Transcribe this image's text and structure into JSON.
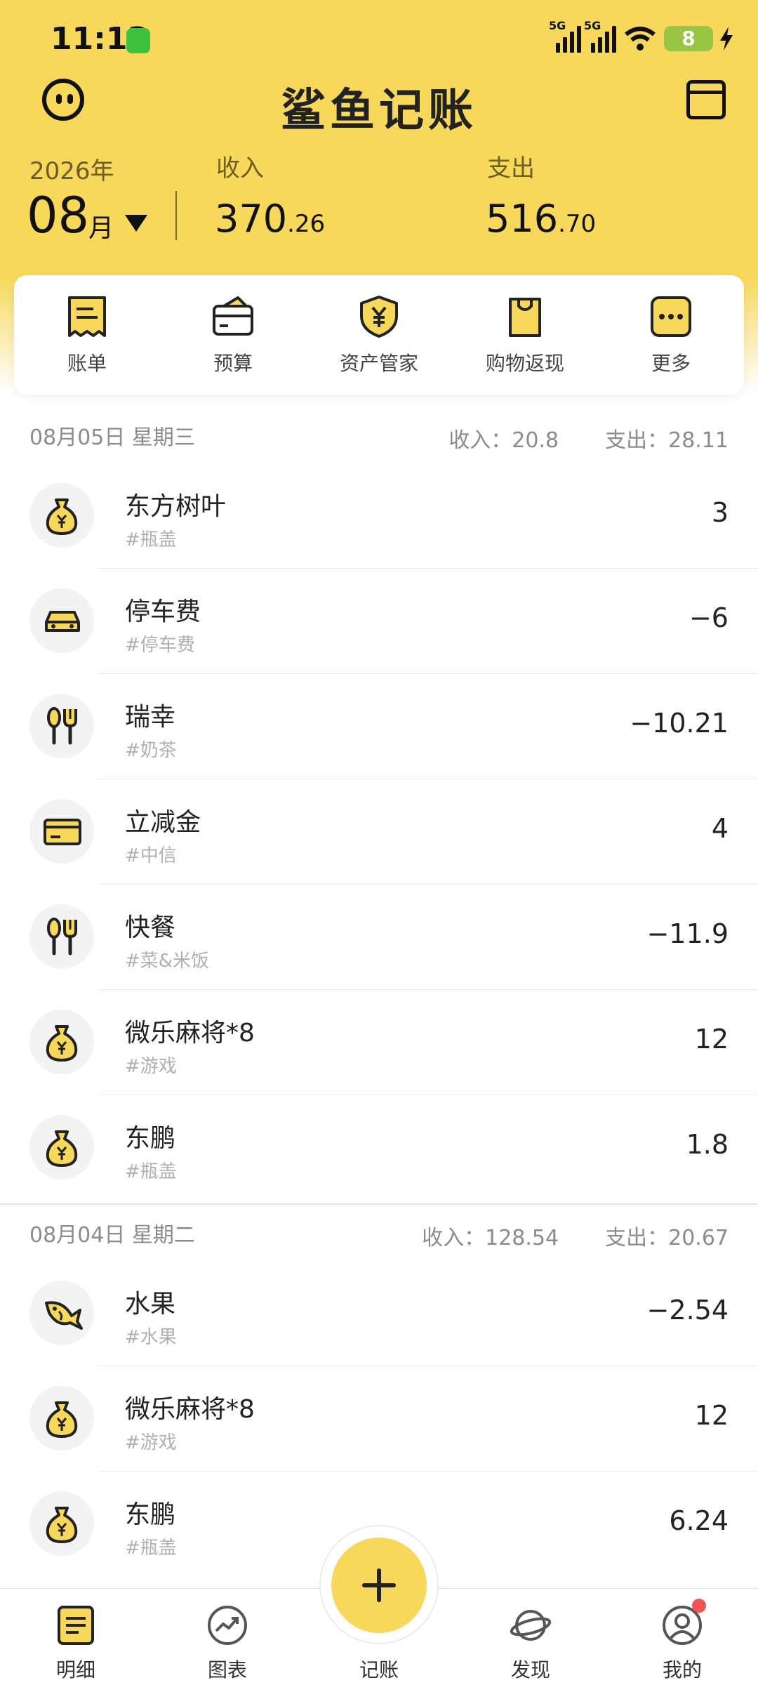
{
  "status_bar": {
    "time": "11:13",
    "signal1": "5G",
    "signal2": "5G",
    "battery": "8"
  },
  "header": {
    "title": "鲨鱼记账",
    "year": "2026年",
    "month": "08",
    "month_unit": "月",
    "income_label": "收入",
    "income_int": "370",
    "income_dec": ".26",
    "expense_label": "支出",
    "expense_int": "516",
    "expense_dec": ".70"
  },
  "quick_actions": [
    {
      "label": "账单",
      "icon": "bill-icon"
    },
    {
      "label": "预算",
      "icon": "wallet-icon"
    },
    {
      "label": "资产管家",
      "icon": "shield-yen-icon"
    },
    {
      "label": "购物返现",
      "icon": "shopping-bag-icon"
    },
    {
      "label": "更多",
      "icon": "more-icon"
    }
  ],
  "days": [
    {
      "date": "08月05日 星期三",
      "income": "收入：20.8",
      "expense": "支出：28.11",
      "items": [
        {
          "name": "东方树叶",
          "tag": "#瓶盖",
          "amount": "3",
          "icon": "money-bag-icon"
        },
        {
          "name": "停车费",
          "tag": "#停车费",
          "amount": "−6",
          "icon": "car-icon"
        },
        {
          "name": "瑞幸",
          "tag": "#奶茶",
          "amount": "−10.21",
          "icon": "cutlery-icon"
        },
        {
          "name": "立减金",
          "tag": "#中信",
          "amount": "4",
          "icon": "card-icon"
        },
        {
          "name": "快餐",
          "tag": "#菜&米饭",
          "amount": "−11.9",
          "icon": "cutlery-icon"
        },
        {
          "name": "微乐麻将*8",
          "tag": "#游戏",
          "amount": "12",
          "icon": "money-bag-icon"
        },
        {
          "name": "东鹏",
          "tag": "#瓶盖",
          "amount": "1.8",
          "icon": "money-bag-icon"
        }
      ]
    },
    {
      "date": "08月04日 星期二",
      "income": "收入：128.54",
      "expense": "支出：20.67",
      "items": [
        {
          "name": "水果",
          "tag": "#水果",
          "amount": "−2.54",
          "icon": "fish-icon"
        },
        {
          "name": "微乐麻将*8",
          "tag": "#游戏",
          "amount": "12",
          "icon": "money-bag-icon"
        },
        {
          "name": "东鹏",
          "tag": "#瓶盖",
          "amount": "6.24",
          "icon": "money-bag-icon"
        }
      ]
    }
  ],
  "bottom_nav": [
    {
      "label": "明细",
      "icon": "detail-icon"
    },
    {
      "label": "图表",
      "icon": "chart-icon"
    },
    {
      "label": "记账",
      "icon": "add-icon"
    },
    {
      "label": "发现",
      "icon": "planet-icon"
    },
    {
      "label": "我的",
      "icon": "profile-icon"
    }
  ],
  "colors": {
    "accent": "#f7d85a",
    "icon_fill": "#f7d85a",
    "badge": "#f05454"
  }
}
